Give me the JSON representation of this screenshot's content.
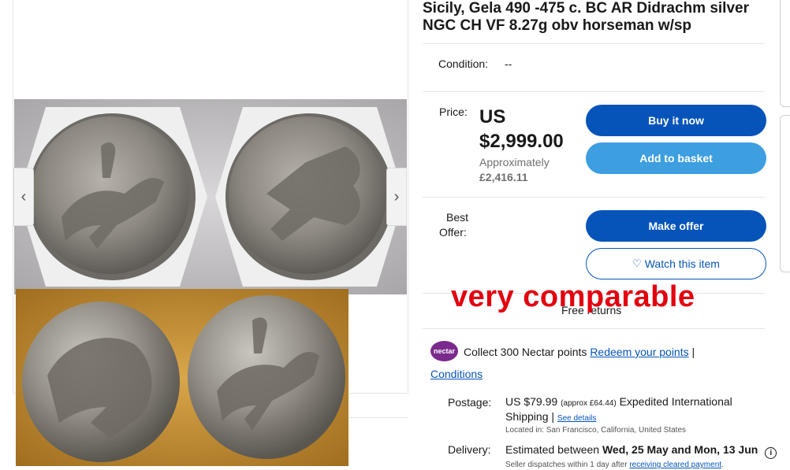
{
  "listing": {
    "title": "Sicily, Gela 490 -475 c. BC AR Didrachm silver NGC CH VF 8.27g obv horseman w/sp"
  },
  "condition": {
    "label": "Condition:",
    "value": "--"
  },
  "price": {
    "label": "Price:",
    "currency": "US",
    "amount": "$2,999.00",
    "approx_label": "Approximately",
    "approx_value": "£2,416.11"
  },
  "best_offer": {
    "label_line1": "Best",
    "label_line2": "Offer:"
  },
  "actions": {
    "buy_now": "Buy it now",
    "add_to_basket": "Add to basket",
    "make_offer": "Make offer",
    "watch": "Watch this item"
  },
  "returns": {
    "text": "Free returns"
  },
  "overlay": {
    "text": "very comparable"
  },
  "nectar": {
    "logo": "nectar",
    "text": "Collect 300 Nectar points",
    "redeem_link": "Redeem your points",
    "separator": "|",
    "conditions_link": "Conditions"
  },
  "postage": {
    "label": "Postage:",
    "amount": "US $79.99",
    "approx": "(approx £64.44)",
    "service": "Expedited International Shipping",
    "separator": "|",
    "details_link": "See details",
    "location": "Located in: San Francisco, California, United States"
  },
  "delivery": {
    "label": "Delivery:",
    "prefix": "Estimated between",
    "range": "Wed, 25 May and Mon, 13 Jun",
    "dispatch_text": "Seller dispatches within 1 day after",
    "dispatch_link": "receiving cleared payment",
    "dispatch_end": "."
  },
  "gallery": {
    "prev_icon": "chevron-left-icon",
    "next_icon": "chevron-right-icon",
    "prev_glyph": "‹",
    "next_glyph": "›"
  },
  "colors": {
    "primary": "#0654ba",
    "secondary": "#3d9ee0",
    "overlay": "#e3000f",
    "nectar": "#7a2a8c"
  }
}
